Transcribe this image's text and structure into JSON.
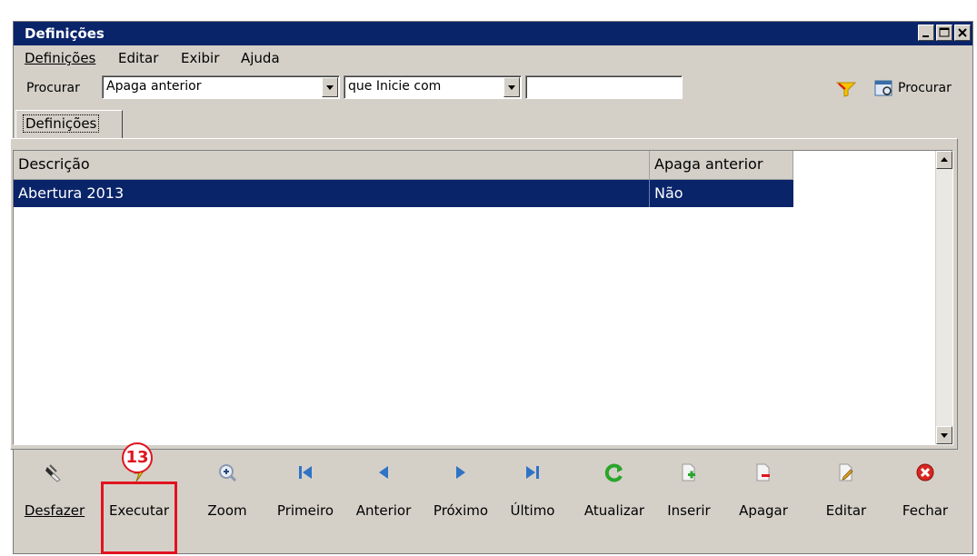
{
  "window": {
    "title": "Definições"
  },
  "menu": [
    "Definições",
    "Editar",
    "Exibir",
    "Ajuda"
  ],
  "search": {
    "label": "Procurar",
    "field_value": "Apaga anterior",
    "condition_value": "que Inicie com",
    "text_value": "",
    "button_label": "Procurar"
  },
  "tab": {
    "label": "Definições"
  },
  "table": {
    "columns": [
      "Descrição",
      "Apaga anterior"
    ],
    "rows": [
      [
        "Abertura 2013",
        "Não"
      ]
    ]
  },
  "toolbar": {
    "buttons": [
      "Desfazer",
      "Executar",
      "Zoom",
      "Primeiro",
      "Anterior",
      "Próximo",
      "Último",
      "Atualizar",
      "Inserir",
      "Apagar",
      "Editar",
      "Fechar"
    ]
  },
  "annotation": {
    "number": "13",
    "color": "#e0141e"
  },
  "colors": {
    "titlebar": "#0a246a",
    "selection": "#0a246a",
    "window_bg": "#d4d0c8"
  }
}
